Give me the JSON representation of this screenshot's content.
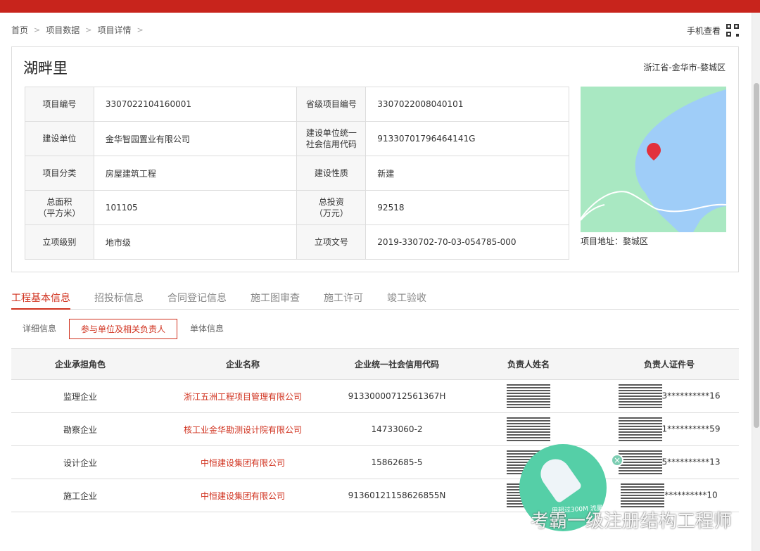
{
  "breadcrumb": [
    "首页",
    "项目数据",
    "项目详情"
  ],
  "mobile_view_label": "手机查看",
  "project": {
    "title": "湖畔里",
    "location": "浙江省-金华市-婺城区",
    "address_label": "项目地址：婺城区"
  },
  "info_rows": [
    {
      "k1": "项目编号",
      "v1": "3307022104160001",
      "k2": "省级项目编号",
      "v2": "3307022008040101"
    },
    {
      "k1": "建设单位",
      "v1": "金华智园置业有限公司",
      "k2": "建设单位统一\n社会信用代码",
      "v2": "91330701796464141G"
    },
    {
      "k1": "项目分类",
      "v1": "房屋建筑工程",
      "k2": "建设性质",
      "v2": "新建"
    },
    {
      "k1": "总面积\n（平方米）",
      "v1": "101105",
      "k2": "总投资\n（万元）",
      "v2": "92518"
    },
    {
      "k1": "立项级别",
      "v1": "地市级",
      "k2": "立项文号",
      "v2": "2019-330702-70-03-054785-000"
    }
  ],
  "tabs": [
    {
      "label": "工程基本信息",
      "active": true
    },
    {
      "label": "招投标信息",
      "active": false
    },
    {
      "label": "合同登记信息",
      "active": false
    },
    {
      "label": "施工图审查",
      "active": false
    },
    {
      "label": "施工许可",
      "active": false
    },
    {
      "label": "竣工验收",
      "active": false
    }
  ],
  "subtabs": [
    {
      "label": "详细信息",
      "active": false
    },
    {
      "label": "参与单位及相关负责人",
      "active": true
    },
    {
      "label": "单体信息",
      "active": false
    }
  ],
  "table": {
    "headers": [
      "企业承担角色",
      "企业名称",
      "企业统一社会信用代码",
      "负责人姓名",
      "负责人证件号"
    ],
    "rows": [
      {
        "role": "监理企业",
        "company": "浙江五洲工程项目管理有限公司",
        "code": "91330000712561367H",
        "id": "3**********16"
      },
      {
        "role": "勘察企业",
        "company": "核工业金华勘测设计院有限公司",
        "code": "14733060-2",
        "id": "1**********59"
      },
      {
        "role": "设计企业",
        "company": "中恒建设集团有限公司",
        "code": "15862685-5",
        "id": "5**********13"
      },
      {
        "role": "施工企业",
        "company": "中恒建设集团有限公司",
        "code": "91360121158626855N",
        "id": "**********10"
      }
    ]
  },
  "watermark": "考霸一级注册结构工程师",
  "promo_text": "用超过300M 流量优化"
}
